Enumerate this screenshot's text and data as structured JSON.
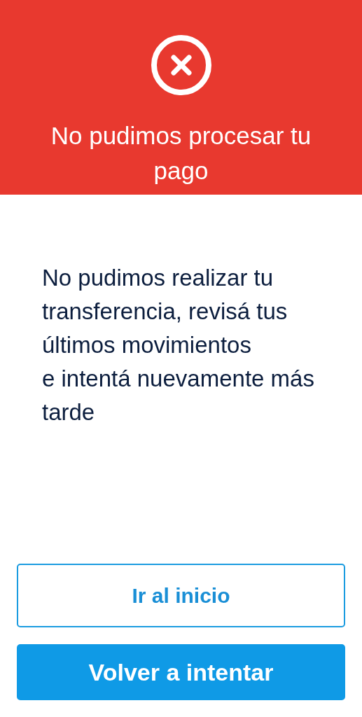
{
  "header": {
    "title": "No pudimos procesar tu pago"
  },
  "message": "No pudimos realizar tu transferencia, revisá tus últimos movimientos\ne intentá nuevamente más tarde",
  "buttons": [
    {
      "label": "Ir al inicio",
      "kind": "outline"
    },
    {
      "label": "Volver a intentar",
      "kind": "filled"
    }
  ]
}
